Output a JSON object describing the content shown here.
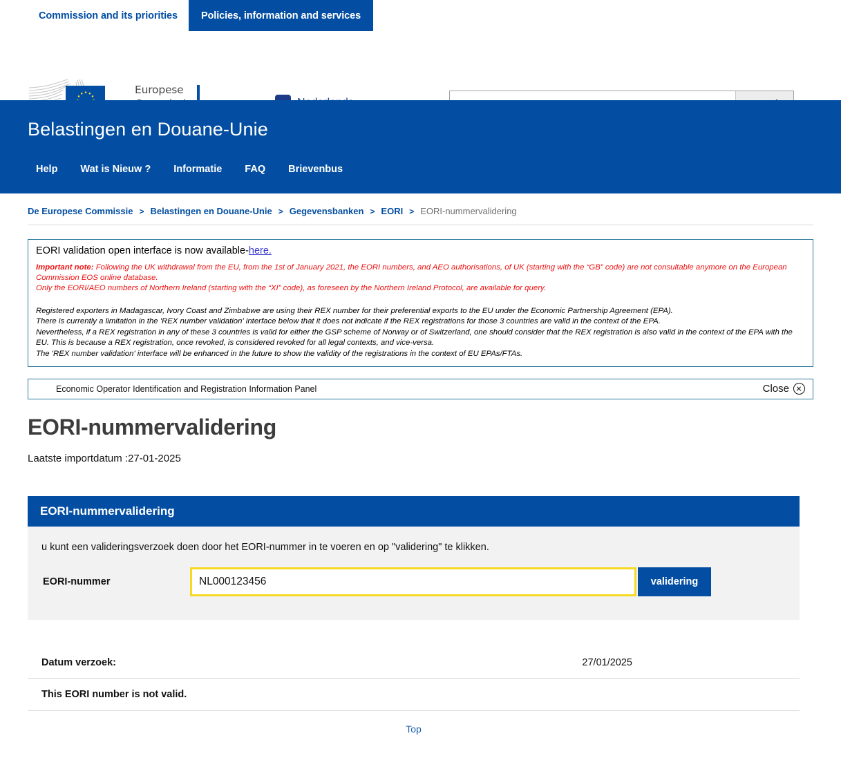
{
  "topbar": {
    "tabs": [
      {
        "label": "Commission and its priorities",
        "active": false
      },
      {
        "label": "Policies, information and services",
        "active": true
      }
    ]
  },
  "utility": {
    "logo": {
      "line1": "Europese",
      "line2": "Commissie",
      "alt": "eu-flag-icon"
    },
    "language": {
      "code": "NL",
      "label": "Nederlands"
    },
    "search": {
      "value": "",
      "placeholder": "",
      "button_label": "Search"
    }
  },
  "site": {
    "title": "Belastingen en Douane-Unie",
    "nav": [
      "Help",
      "Wat is Nieuw ?",
      "Informatie",
      "FAQ",
      "Brievenbus"
    ]
  },
  "breadcrumb": {
    "items": [
      "De Europese Commissie",
      "Belastingen en Douane-Unie",
      "Gegevensbanken",
      "EORI"
    ],
    "current": "EORI-nummervalidering",
    "separator": ">"
  },
  "notice": {
    "line1_before": "EORI validation open interface is now available-",
    "line1_link": "here.",
    "important_label": "Important note:",
    "red_1": " Following the UK withdrawal from the EU, from the 1st of January 2021, the EORI numbers, and AEO authorisations, of UK (starting with the “GB” code) are not consultable anymore on the European Commission EOS online database.",
    "red_2": "Only the EORI/AEO numbers of Northern Ireland (starting with the “XI” code), as foreseen by the Northern Ireland Protocol, are available for query.",
    "black_1": "Registered exporters in Madagascar, Ivory Coast and Zimbabwe are using their REX number for their preferential exports to the EU under the Economic Partnership Agreement (EPA).",
    "black_2": "There is currently a limitation in the 'REX number validation' interface below that it does not indicate if the REX registrations for those 3 countries are valid in the context of the EPA.",
    "black_3": "Nevertheless, if a REX registration in any of these 3 countries is valid for either the GSP scheme of Norway or of Switzerland, one should consider that the REX registration is also valid in the context of the EPA with the EU. This is because a REX registration, once revoked, is considered revoked for all legal contexts, and vice-versa.",
    "black_4": "The 'REX number validation' interface will be enhanced in the future to show the validity of the registrations in the context of EU EPAs/FTAs.",
    "border_color": "#2b7a9b",
    "red_color": "#ee1111"
  },
  "panel_bar": {
    "label": "Economic Operator Identification and Registration Information Panel",
    "close_label": "Close"
  },
  "page": {
    "title": "EORI-nummervalidering",
    "import_date": "Laatste importdatum :27-01-2025"
  },
  "card": {
    "heading": "EORI-nummervalidering",
    "hint": "u kunt een valideringsverzoek doen door het EORI-nummer in te voeren en op \"validering\" te klikken.",
    "field_label": "EORI-nummer",
    "field_value": "NL000123456",
    "field_placeholder": "",
    "button_label": "validering",
    "accent_color": "#034ea2",
    "focus_border_color": "#f5d922"
  },
  "results": {
    "date_label": "Datum verzoek:",
    "date_value": "27/01/2025",
    "message": "This EORI number is not valid."
  },
  "footer": {
    "top_link": "Top"
  }
}
